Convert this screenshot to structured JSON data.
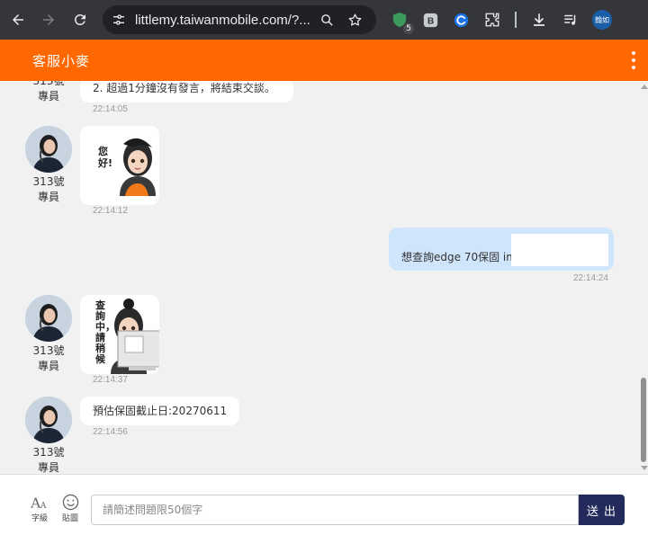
{
  "browser": {
    "url": "littlemy.taiwanmobile.com/?...",
    "extension_badge": "5",
    "profile_label": "翰如"
  },
  "app": {
    "title": "客服小麥"
  },
  "agent": {
    "name": "313號專員"
  },
  "messages": [
    {
      "text": "2. 超過1分鐘沒有發言，將結束交談。",
      "time": "22:14:05"
    },
    {
      "sticker_text": "您好!",
      "time": "22:14:12"
    },
    {
      "text": "想查詢edge 70保固 ime",
      "time": "22:14:24"
    },
    {
      "sticker_text": "查詢中，請稍候",
      "time": "22:14:37"
    },
    {
      "text": "預估保固截止日:20270611",
      "time": "22:14:56"
    }
  ],
  "composer": {
    "font_size_label": "字級",
    "sticker_label": "貼圖",
    "placeholder": "請簡述問題限50個字",
    "send_label": "送 出"
  },
  "colors": {
    "brand": "#ff6800",
    "send_button": "#232b5c",
    "user_bubble": "#cfe5fb"
  }
}
